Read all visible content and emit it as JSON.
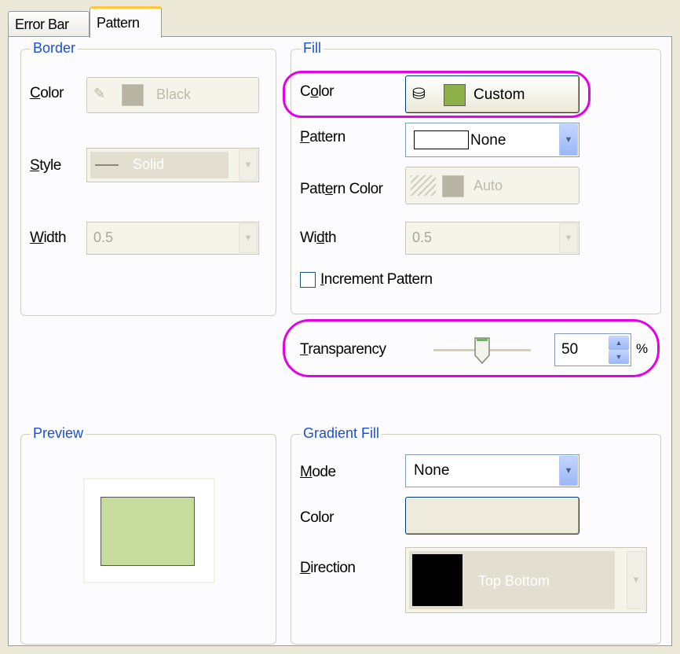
{
  "tabs": [
    "Error Bar",
    "Pattern"
  ],
  "border": {
    "title": "Border",
    "color_label": "Color",
    "color_value": "Black",
    "style_label": "Style",
    "style_value": "Solid",
    "width_label": "Width",
    "width_value": "0.5"
  },
  "fill": {
    "title": "Fill",
    "color_label": "Color",
    "color_value": "Custom",
    "color_hex": "#8db04a",
    "pattern_label": "Pattern",
    "pattern_value": "None",
    "pattern_color_label": "Pattern Color",
    "pattern_color_value": "Auto",
    "width_label": "Width",
    "width_value": "0.5",
    "increment_label": "Increment Pattern",
    "increment_checked": false
  },
  "transparency": {
    "label": "Transparency",
    "value": "50",
    "unit": "%",
    "level": 0.5
  },
  "preview": {
    "title": "Preview",
    "fill_hex": "#c6dc9c"
  },
  "gradient": {
    "title": "Gradient Fill",
    "mode_label": "Mode",
    "mode_value": "None",
    "color_label": "Color",
    "direction_label": "Direction",
    "direction_value": "Top Bottom"
  },
  "colors": {
    "accent_highlight": "#e600e6",
    "group_title": "#1a4fd6"
  }
}
